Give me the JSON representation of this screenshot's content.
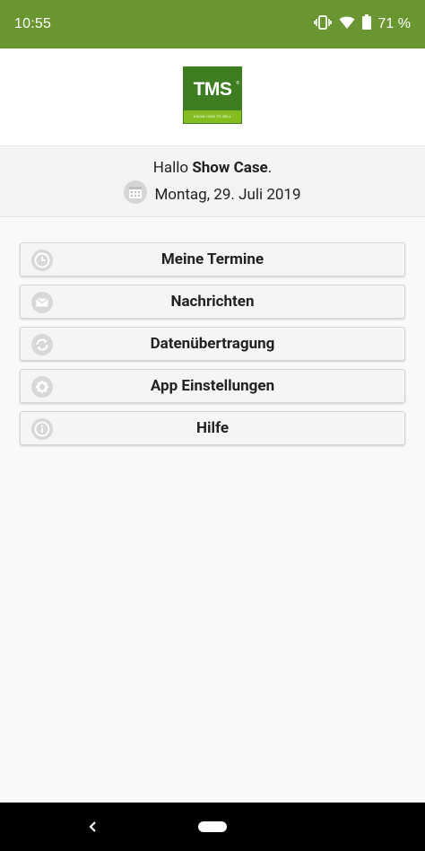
{
  "status_bar": {
    "time": "10:55",
    "battery_percent": "71 %",
    "background_color": "#6a9632"
  },
  "logo": {
    "text": "TMS",
    "registered_mark": "®",
    "slogan": "KNOW HOW TO SELL",
    "color_dark": "#3f7d22",
    "color_light": "#84bd1e"
  },
  "greeting": {
    "prefix": "Hallo ",
    "name": "Show Case",
    "suffix": ".",
    "date": "Montag, 29. Juli 2019",
    "date_icon": "calendar-icon"
  },
  "menu": {
    "items": [
      {
        "label": "Meine Termine",
        "icon": "clock-icon"
      },
      {
        "label": "Nachrichten",
        "icon": "envelope-icon"
      },
      {
        "label": "Datenübertragung",
        "icon": "sync-icon"
      },
      {
        "label": "App Einstellungen",
        "icon": "gear-icon"
      },
      {
        "label": "Hilfe",
        "icon": "info-icon"
      }
    ]
  },
  "nav_bar": {
    "back_icon": "back-chevron-icon",
    "home_icon": "home-pill-icon"
  }
}
